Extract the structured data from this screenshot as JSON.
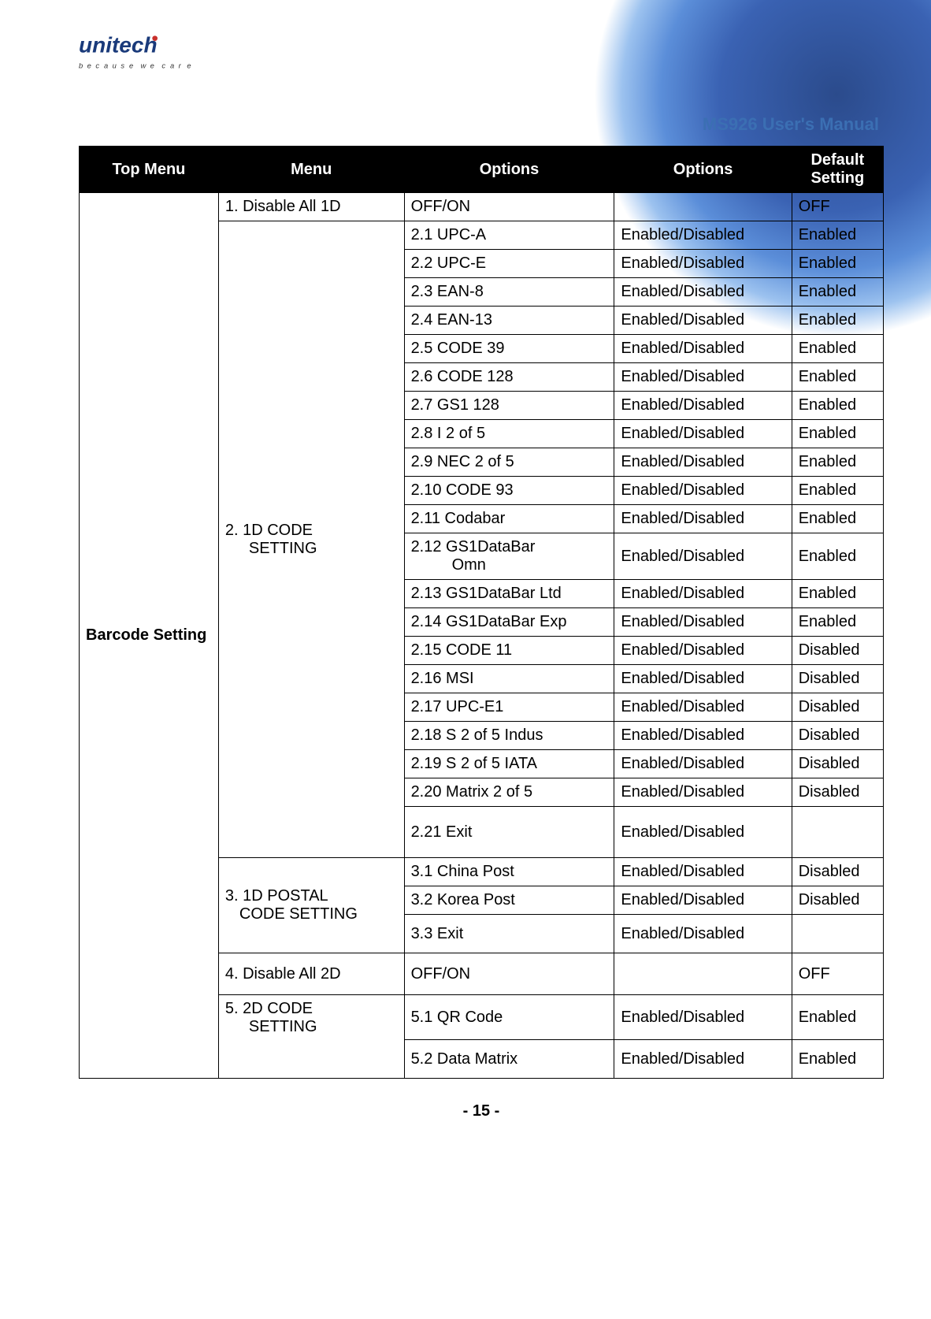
{
  "logo": {
    "brand": "unitech",
    "tagline_chars": [
      "b",
      "e",
      "c",
      "a",
      "u",
      "s",
      "e",
      "w",
      "e",
      "c",
      "a",
      "r",
      "e"
    ]
  },
  "doc_title": "MS926 User's Manual",
  "headers": {
    "h1": "Top Menu",
    "h2": "Menu",
    "h3": "Options",
    "h4": "Options",
    "h5": "Default Setting"
  },
  "top_menu": "Barcode Setting",
  "menus": {
    "m1": "1. Disable All 1D",
    "m2a": "2. 1D CODE",
    "m2b": "SETTING",
    "m3a": "3. 1D POSTAL",
    "m3b": "CODE SETTING",
    "m4": "4. Disable All 2D",
    "m5a": "5. 2D CODE",
    "m5b": "SETTING"
  },
  "rows": [
    {
      "o1": "OFF/ON",
      "o2": "",
      "d": "OFF"
    },
    {
      "o1": "2.1 UPC-A",
      "o2": "Enabled/Disabled",
      "d": "Enabled"
    },
    {
      "o1": "2.2 UPC-E",
      "o2": "Enabled/Disabled",
      "d": "Enabled"
    },
    {
      "o1": "2.3 EAN-8",
      "o2": "Enabled/Disabled",
      "d": "Enabled"
    },
    {
      "o1": "2.4 EAN-13",
      "o2": "Enabled/Disabled",
      "d": "Enabled"
    },
    {
      "o1": "2.5 CODE 39",
      "o2": "Enabled/Disabled",
      "d": "Enabled"
    },
    {
      "o1": "2.6 CODE 128",
      "o2": "Enabled/Disabled",
      "d": "Enabled"
    },
    {
      "o1": "2.7 GS1 128",
      "o2": "Enabled/Disabled",
      "d": "Enabled"
    },
    {
      "o1": "2.8 I 2 of 5",
      "o2": "Enabled/Disabled",
      "d": "Enabled"
    },
    {
      "o1": "2.9 NEC 2 of 5",
      "o2": "Enabled/Disabled",
      "d": "Enabled"
    },
    {
      "o1": "2.10 CODE 93",
      "o2": "Enabled/Disabled",
      "d": "Enabled"
    },
    {
      "o1": "2.11 Codabar",
      "o2": "Enabled/Disabled",
      "d": "Enabled"
    },
    {
      "o1a": "2.12 GS1DataBar",
      "o1b": "Omn",
      "o2": "Enabled/Disabled",
      "d": "Enabled"
    },
    {
      "o1": "2.13 GS1DataBar Ltd",
      "o2": "Enabled/Disabled",
      "d": "Enabled"
    },
    {
      "o1": "2.14 GS1DataBar Exp",
      "o2": "Enabled/Disabled",
      "d": "Enabled"
    },
    {
      "o1": "2.15 CODE 11",
      "o2": "Enabled/Disabled",
      "d": "Disabled"
    },
    {
      "o1": "2.16 MSI",
      "o2": "Enabled/Disabled",
      "d": "Disabled"
    },
    {
      "o1": "2.17 UPC-E1",
      "o2": "Enabled/Disabled",
      "d": "Disabled"
    },
    {
      "o1": "2.18 S 2 of 5 Indus",
      "o2": "Enabled/Disabled",
      "d": "Disabled"
    },
    {
      "o1": "2.19 S 2 of 5 IATA",
      "o2": "Enabled/Disabled",
      "d": "Disabled"
    },
    {
      "o1": "2.20 Matrix 2 of 5",
      "o2": "Enabled/Disabled",
      "d": "Disabled"
    },
    {
      "o1": "2.21 Exit",
      "o2": "Enabled/Disabled",
      "d": ""
    },
    {
      "o1": "3.1 China Post",
      "o2": "Enabled/Disabled",
      "d": "Disabled"
    },
    {
      "o1": "3.2 Korea Post",
      "o2": "Enabled/Disabled",
      "d": "Disabled"
    },
    {
      "o1": "3.3 Exit",
      "o2": "Enabled/Disabled",
      "d": ""
    },
    {
      "o1": "OFF/ON",
      "o2": "",
      "d": "OFF"
    },
    {
      "o1": "5.1 QR Code",
      "o2": "Enabled/Disabled",
      "d": "Enabled"
    },
    {
      "o1": "5.2 Data Matrix",
      "o2": "Enabled/Disabled",
      "d": "Enabled"
    }
  ],
  "page_number": "- 15 -"
}
